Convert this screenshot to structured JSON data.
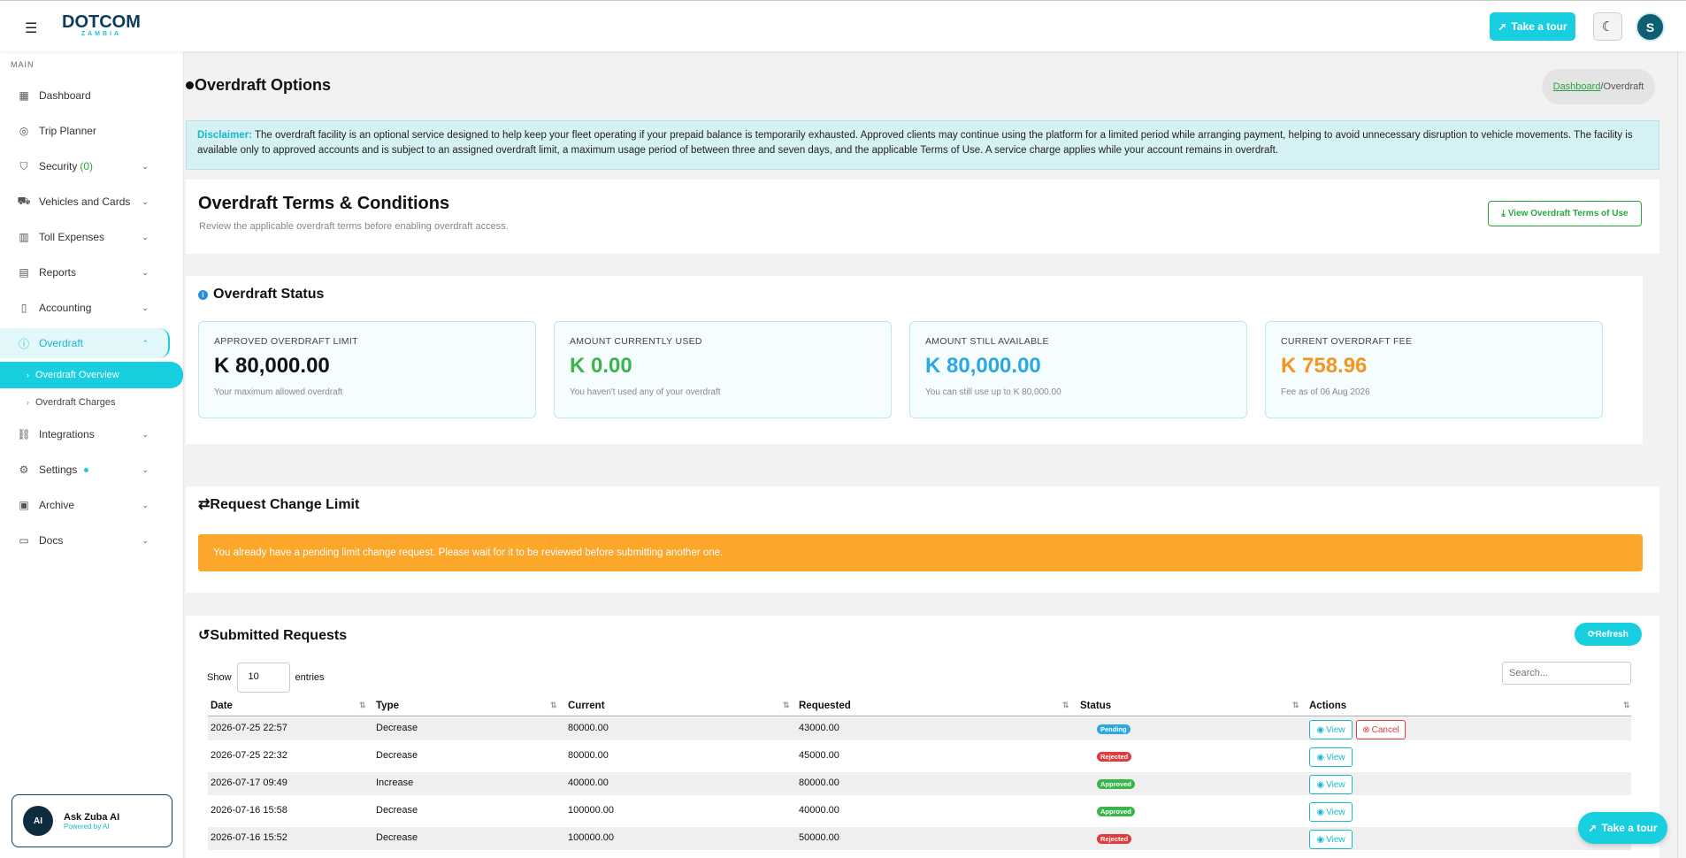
{
  "header": {
    "logo_main": "DOTCOM",
    "logo_sub": "ZAMBIA",
    "tour_label": "Take a tour",
    "avatar_initial": "S"
  },
  "sidebar": {
    "section": "MAIN",
    "items": [
      {
        "label": "Dashboard",
        "icon": "dashboard-icon"
      },
      {
        "label": "Trip Planner",
        "icon": "map-pin-icon"
      },
      {
        "label": "Security",
        "count": "(0)",
        "icon": "shield-icon"
      },
      {
        "label": "Vehicles and Cards",
        "icon": "truck-icon"
      },
      {
        "label": "Toll Expenses",
        "icon": "bar-chart-icon"
      },
      {
        "label": "Reports",
        "icon": "clipboard-icon"
      },
      {
        "label": "Accounting",
        "icon": "book-icon"
      },
      {
        "label": "Overdraft",
        "icon": "alert-circle-icon"
      },
      {
        "label": "Integrations",
        "icon": "link-icon"
      },
      {
        "label": "Settings",
        "icon": "gear-icon"
      },
      {
        "label": "Archive",
        "icon": "archive-icon"
      },
      {
        "label": "Docs",
        "icon": "document-icon"
      }
    ],
    "sub_items": [
      "Overdraft Overview",
      "Overdraft Charges"
    ],
    "zuba_title": "Ask Zuba AI",
    "zuba_sub": "Powered by AI",
    "zuba_icon_text": "AI"
  },
  "page": {
    "title": "Overdraft Options",
    "crumb_link": "Dashboard",
    "crumb_sep": "/",
    "crumb_current": "Overdraft",
    "disclaimer_label": "Disclaimer:",
    "disclaimer_text": " The overdraft facility is an optional service designed to help keep your fleet operating if your prepaid balance is temporarily exhausted. Approved clients may continue using the platform for a limited period while arranging payment, helping to avoid unnecessary disruption to vehicle movements. The facility is available only to approved accounts and is subject to an assigned overdraft limit, a maximum usage period of between three and seven days, and the applicable Terms of Use. A service charge applies while your account remains in overdraft."
  },
  "terms": {
    "title": "Overdraft Terms & Conditions",
    "subtitle": "Review the applicable overdraft terms before enabling overdraft access.",
    "button": "View Overdraft Terms of Use"
  },
  "status": {
    "title": "Overdraft Status",
    "stats": [
      {
        "label": "APPROVED OVERDRAFT LIMIT",
        "value": "K 80,000.00",
        "hint": "Your maximum allowed overdraft",
        "color": "#111111"
      },
      {
        "label": "AMOUNT CURRENTLY USED",
        "value": "K 0.00",
        "hint": "You haven't used any of your overdraft",
        "color": "#3ab54a"
      },
      {
        "label": "AMOUNT STILL AVAILABLE",
        "value": "K 80,000.00",
        "hint": "You can still use up to K 80,000.00",
        "color": "#2aa8e0"
      },
      {
        "label": "CURRENT OVERDRAFT FEE",
        "value": "K 758.96",
        "hint": "Fee as of 06 Aug 2026",
        "color": "#f7941d"
      }
    ]
  },
  "request": {
    "title": "Request Change Limit",
    "warning": "You already have a pending limit change request. Please wait for it to be reviewed before submitting another one."
  },
  "submitted": {
    "title": "Submitted Requests",
    "refresh": "Refresh",
    "show_label": "Show",
    "entries_value": "10",
    "entries_label": "entries",
    "search_placeholder": "Search...",
    "columns": [
      "Date",
      "Type",
      "Current",
      "Requested",
      "Status",
      "Actions"
    ],
    "view_label": "View",
    "cancel_label": "Cancel",
    "rows": [
      {
        "date": "2026-07-25 22:57",
        "type": "Decrease",
        "current": "80000.00",
        "requested": "43000.00",
        "status": "Pending"
      },
      {
        "date": "2026-07-25 22:32",
        "type": "Decrease",
        "current": "80000.00",
        "requested": "45000.00",
        "status": "Rejected"
      },
      {
        "date": "2026-07-17 09:49",
        "type": "Increase",
        "current": "40000.00",
        "requested": "80000.00",
        "status": "Approved"
      },
      {
        "date": "2026-07-16 15:58",
        "type": "Decrease",
        "current": "100000.00",
        "requested": "40000.00",
        "status": "Approved"
      },
      {
        "date": "2026-07-16 15:52",
        "type": "Decrease",
        "current": "100000.00",
        "requested": "50000.00",
        "status": "Rejected"
      }
    ]
  },
  "floating_tour": "Take a tour"
}
